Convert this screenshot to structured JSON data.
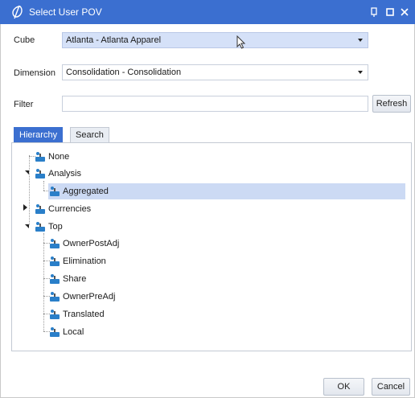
{
  "window": {
    "title": "Select User POV"
  },
  "form": {
    "cube_label": "Cube",
    "cube_value": "Atlanta - Atlanta Apparel",
    "dimension_label": "Dimension",
    "dimension_value": "Consolidation - Consolidation",
    "filter_label": "Filter",
    "filter_value": "",
    "refresh_label": "Refresh"
  },
  "tabs": [
    {
      "label": "Hierarchy",
      "active": true
    },
    {
      "label": "Search",
      "active": false
    }
  ],
  "tree": {
    "none": "None",
    "analysis": "Analysis",
    "aggregated": "Aggregated",
    "currencies": "Currencies",
    "top": "Top",
    "top_children": [
      "OwnerPostAdj",
      "Elimination",
      "Share",
      "OwnerPreAdj",
      "Translated",
      "Local"
    ]
  },
  "footer": {
    "ok_label": "OK",
    "cancel_label": "Cancel"
  },
  "colors": {
    "titlebar": "#3b6fd0",
    "selection": "#ccdaf4",
    "combo_highlight": "#d5e1f8"
  },
  "icons": {
    "app": "onestream-logo-icon",
    "member": "member-node-icon"
  }
}
